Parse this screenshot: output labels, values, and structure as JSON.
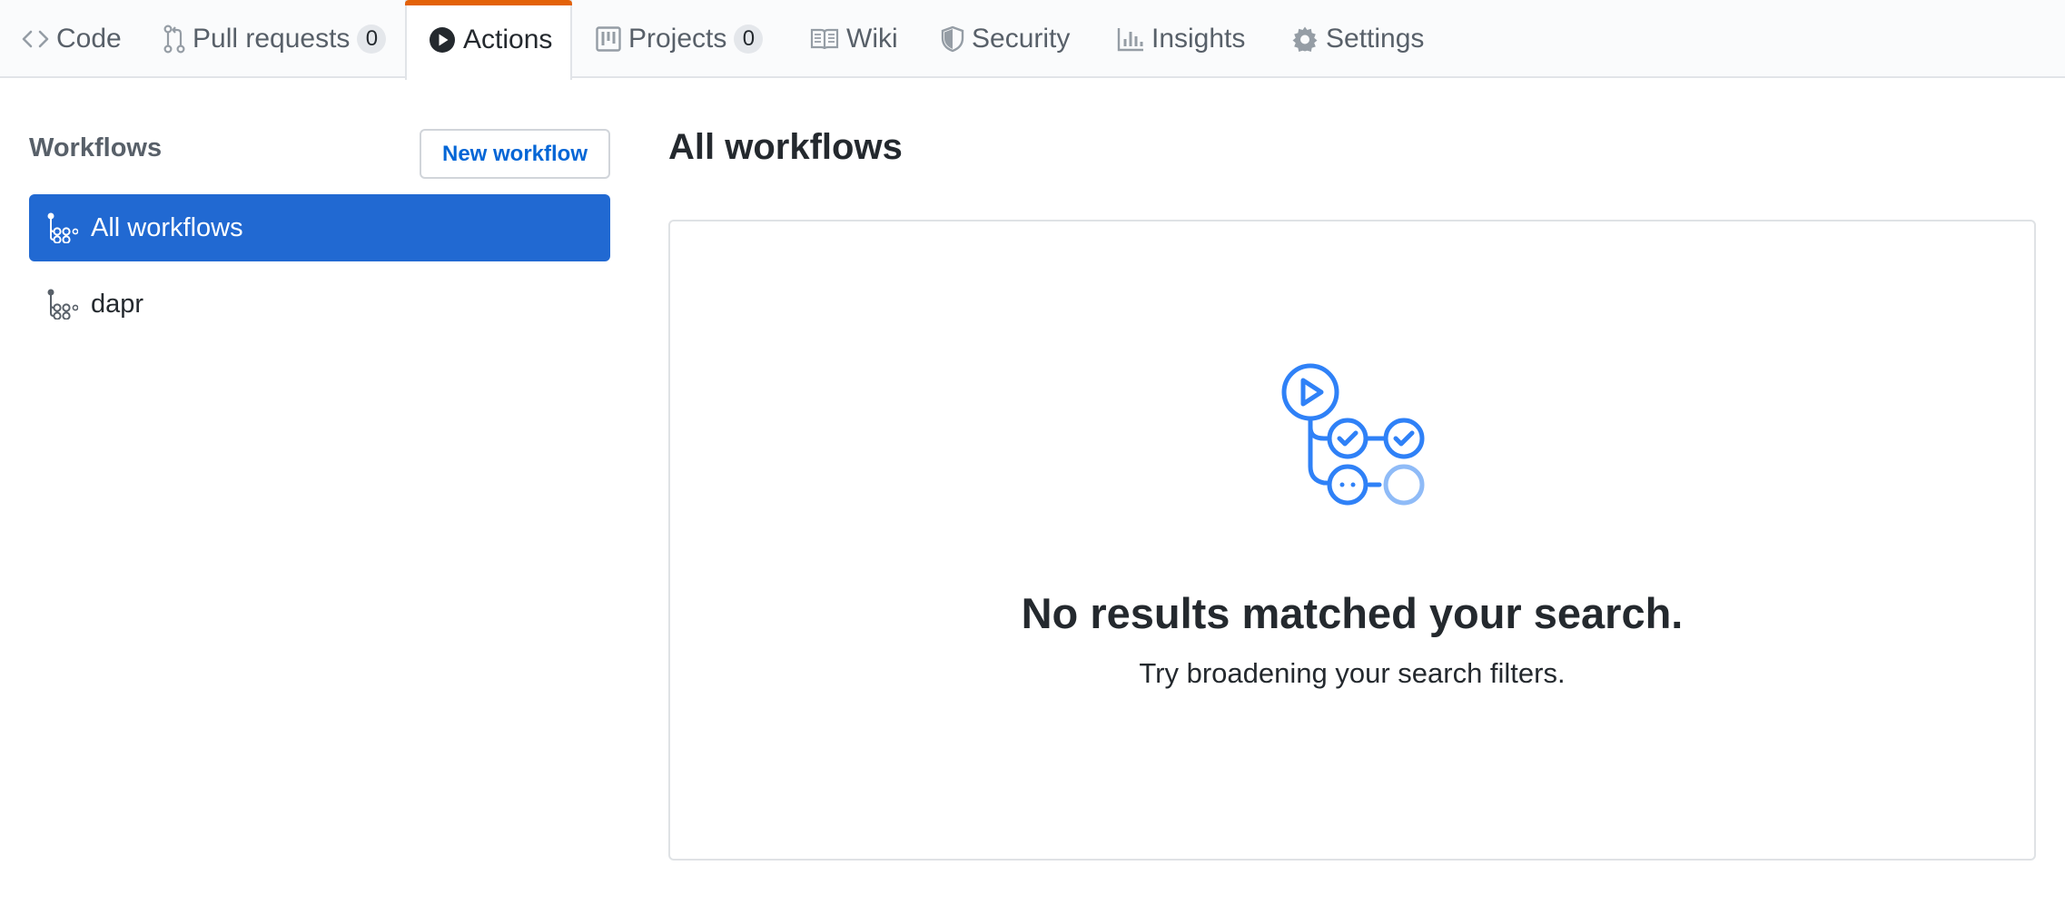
{
  "nav": {
    "tabs": [
      {
        "label": "Code",
        "icon": "code-icon"
      },
      {
        "label": "Pull requests",
        "icon": "git-pull-request-icon",
        "count": "0"
      },
      {
        "label": "Actions",
        "icon": "play-icon",
        "selected": true
      },
      {
        "label": "Projects",
        "icon": "project-icon",
        "count": "0"
      },
      {
        "label": "Wiki",
        "icon": "book-icon"
      },
      {
        "label": "Security",
        "icon": "shield-icon"
      },
      {
        "label": "Insights",
        "icon": "graph-icon"
      },
      {
        "label": "Settings",
        "icon": "gear-icon"
      }
    ]
  },
  "sidebar": {
    "title": "Workflows",
    "new_workflow_label": "New workflow",
    "items": [
      {
        "label": "All workflows",
        "icon": "workflow-icon",
        "selected": true
      },
      {
        "label": "dapr",
        "icon": "workflow-icon"
      }
    ]
  },
  "main": {
    "title": "All workflows",
    "empty_state": {
      "illustration": "workflow-illustration",
      "heading": "No results matched your search.",
      "subtext": "Try broadening your search filters."
    }
  },
  "colors": {
    "accent_tab": "#e36209",
    "selected_item_bg": "#2169d2",
    "link": "#0366d6",
    "illustration_blue": "#2f81f7"
  }
}
